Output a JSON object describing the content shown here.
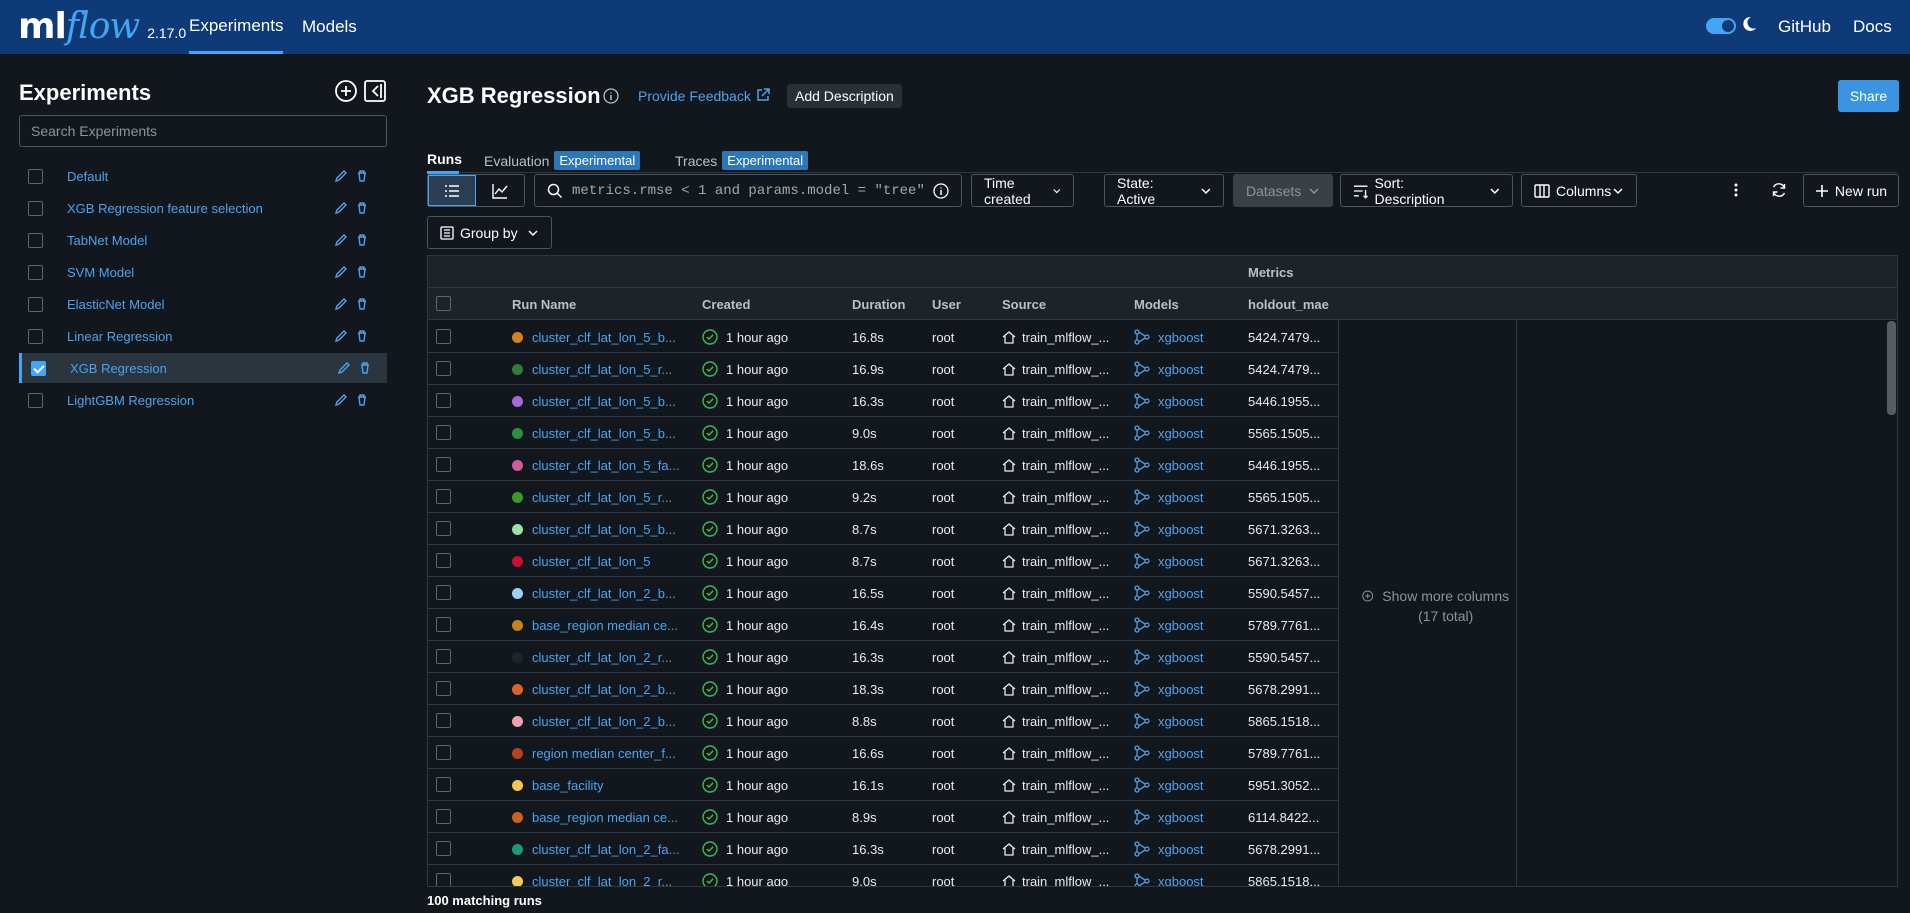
{
  "topbar": {
    "logo_ml": "ml",
    "logo_flow": "flow",
    "version": "2.17.0",
    "tabs": [
      {
        "label": "Experiments"
      },
      {
        "label": "Models"
      }
    ],
    "github": "GitHub",
    "docs": "Docs",
    "accent": "#43a5f5",
    "bg": "#0e3b78"
  },
  "sidebar": {
    "title": "Experiments",
    "search_placeholder": "Search Experiments",
    "experiments": [
      {
        "name": "Default",
        "selected": false
      },
      {
        "name": "XGB Regression feature selection",
        "selected": false
      },
      {
        "name": "TabNet Model",
        "selected": false
      },
      {
        "name": "SVM Model",
        "selected": false
      },
      {
        "name": "ElasticNet Model",
        "selected": false
      },
      {
        "name": "Linear Regression",
        "selected": false
      },
      {
        "name": "XGB Regression",
        "selected": true
      },
      {
        "name": "LightGBM Regression",
        "selected": false
      }
    ]
  },
  "main": {
    "title": "XGB Regression",
    "feedback": "Provide Feedback",
    "add_description": "Add Description",
    "share": "Share",
    "tabs": [
      {
        "label": "Runs",
        "badge": ""
      },
      {
        "label": "Evaluation",
        "badge": "Experimental"
      },
      {
        "label": "Traces",
        "badge": "Experimental"
      }
    ],
    "filter_text": "metrics.rmse < 1 and params.model = \"tree\"",
    "time_created": "Time created",
    "state": "State: Active",
    "datasets": "Datasets",
    "sort": "Sort: Description",
    "columns": "Columns",
    "new_run": "New run",
    "group_by": "Group by"
  },
  "grid": {
    "group_header": "Metrics",
    "columns": [
      "Run Name",
      "Created",
      "Duration",
      "User",
      "Source",
      "Models",
      "holdout_mae"
    ],
    "show_more": "Show more columns (17 total)",
    "rows": [
      {
        "name": "cluster_clf_lat_lon_5_b...",
        "color": "#d4831f",
        "created": "1 hour ago",
        "duration": "16.8s",
        "user": "root",
        "source": "train_mlflow_...",
        "model": "xgboost",
        "mae": "5424.7479..."
      },
      {
        "name": "cluster_clf_lat_lon_5_r...",
        "color": "#2e7d3a",
        "created": "1 hour ago",
        "duration": "16.9s",
        "user": "root",
        "source": "train_mlflow_...",
        "model": "xgboost",
        "mae": "5424.7479..."
      },
      {
        "name": "cluster_clf_lat_lon_5_b...",
        "color": "#a66ad8",
        "created": "1 hour ago",
        "duration": "16.3s",
        "user": "root",
        "source": "train_mlflow_...",
        "model": "xgboost",
        "mae": "5446.1955..."
      },
      {
        "name": "cluster_clf_lat_lon_5_b...",
        "color": "#2a8f3f",
        "created": "1 hour ago",
        "duration": "9.0s",
        "user": "root",
        "source": "train_mlflow_...",
        "model": "xgboost",
        "mae": "5565.1505..."
      },
      {
        "name": "cluster_clf_lat_lon_5_fa...",
        "color": "#d45a9c",
        "created": "1 hour ago",
        "duration": "18.6s",
        "user": "root",
        "source": "train_mlflow_...",
        "model": "xgboost",
        "mae": "5446.1955..."
      },
      {
        "name": "cluster_clf_lat_lon_5_r...",
        "color": "#3a9a2a",
        "created": "1 hour ago",
        "duration": "9.2s",
        "user": "root",
        "source": "train_mlflow_...",
        "model": "xgboost",
        "mae": "5565.1505..."
      },
      {
        "name": "cluster_clf_lat_lon_5_b...",
        "color": "#9ee0a8",
        "created": "1 hour ago",
        "duration": "8.7s",
        "user": "root",
        "source": "train_mlflow_...",
        "model": "xgboost",
        "mae": "5671.3263..."
      },
      {
        "name": "cluster_clf_lat_lon_5",
        "color": "#c8102e",
        "created": "1 hour ago",
        "duration": "8.7s",
        "user": "root",
        "source": "train_mlflow_...",
        "model": "xgboost",
        "mae": "5671.3263..."
      },
      {
        "name": "cluster_clf_lat_lon_2_b...",
        "color": "#9ed0f5",
        "created": "1 hour ago",
        "duration": "16.5s",
        "user": "root",
        "source": "train_mlflow_...",
        "model": "xgboost",
        "mae": "5590.5457..."
      },
      {
        "name": "base_region median ce...",
        "color": "#c8841c",
        "created": "1 hour ago",
        "duration": "16.4s",
        "user": "root",
        "source": "train_mlflow_...",
        "model": "xgboost",
        "mae": "5789.7761..."
      },
      {
        "name": "cluster_clf_lat_lon_2_r...",
        "color": "#1e2428",
        "created": "1 hour ago",
        "duration": "16.3s",
        "user": "root",
        "source": "train_mlflow_...",
        "model": "xgboost",
        "mae": "5590.5457..."
      },
      {
        "name": "cluster_clf_lat_lon_2_b...",
        "color": "#e0602a",
        "created": "1 hour ago",
        "duration": "18.3s",
        "user": "root",
        "source": "train_mlflow_...",
        "model": "xgboost",
        "mae": "5678.2991..."
      },
      {
        "name": "cluster_clf_lat_lon_2_b...",
        "color": "#f2a0b0",
        "created": "1 hour ago",
        "duration": "8.8s",
        "user": "root",
        "source": "train_mlflow_...",
        "model": "xgboost",
        "mae": "5865.1518..."
      },
      {
        "name": "region median center_f...",
        "color": "#b8401e",
        "created": "1 hour ago",
        "duration": "16.6s",
        "user": "root",
        "source": "train_mlflow_...",
        "model": "xgboost",
        "mae": "5789.7761..."
      },
      {
        "name": "base_facility",
        "color": "#f5c452",
        "created": "1 hour ago",
        "duration": "16.1s",
        "user": "root",
        "source": "train_mlflow_...",
        "model": "xgboost",
        "mae": "5951.3052..."
      },
      {
        "name": "base_region median ce...",
        "color": "#d0601e",
        "created": "1 hour ago",
        "duration": "8.9s",
        "user": "root",
        "source": "train_mlflow_...",
        "model": "xgboost",
        "mae": "6114.8422..."
      },
      {
        "name": "cluster_clf_lat_lon_2_fa...",
        "color": "#1a9a7a",
        "created": "1 hour ago",
        "duration": "16.3s",
        "user": "root",
        "source": "train_mlflow_...",
        "model": "xgboost",
        "mae": "5678.2991..."
      },
      {
        "name": "cluster_clf_lat_lon_2_r...",
        "color": "#f5c85a",
        "created": "1 hour ago",
        "duration": "9.0s",
        "user": "root",
        "source": "train_mlflow_...",
        "model": "xgboost",
        "mae": "5865.1518..."
      }
    ],
    "matching": "100 matching runs"
  }
}
